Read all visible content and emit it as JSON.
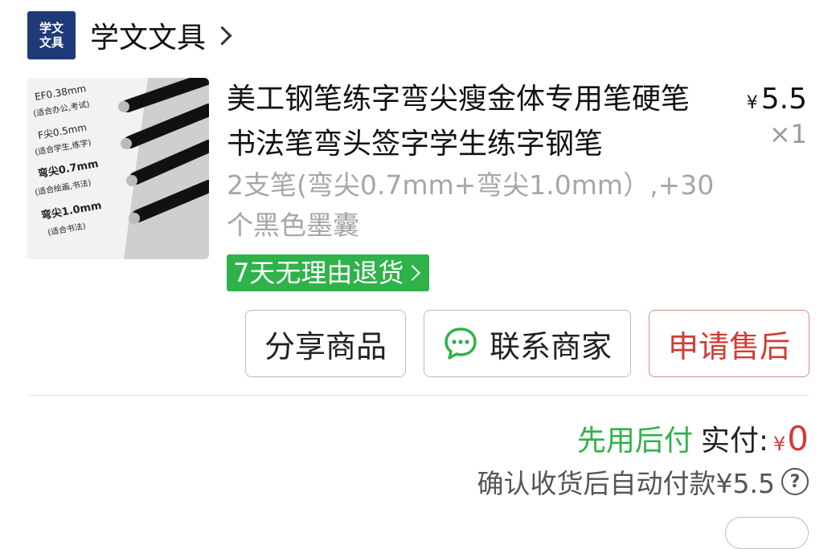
{
  "store": {
    "logo_line1": "学文",
    "logo_line2": "文具",
    "name": "学文文具",
    "chevron_icon": "chevron-right-icon"
  },
  "product": {
    "title": "美工钢笔练字弯尖瘦金体专用笔硬笔书法笔弯头签字学生练字钢笔",
    "price_symbol": "¥",
    "price": "5.5",
    "quantity": "×1",
    "variant": "2支笔(弯尖0.7mm+弯尖1.0mm）,+30个黑色墨囊",
    "return_badge": "7天无理由退货",
    "thumbnail": {
      "labels": [
        "EF0.38mm",
        "(适合办公,考试)",
        "F尖0.5mm",
        "(适合学生,练字)",
        "弯尖0.7mm",
        "(适合绘画,书法)",
        "弯尖1.0mm",
        "(适合书法)"
      ]
    }
  },
  "actions": {
    "share": "分享商品",
    "contact": "联系商家",
    "after_sale": "申请售后"
  },
  "payment": {
    "pay_later": "先用后付",
    "paid_label": "实付:",
    "paid_symbol": "¥",
    "paid_value": "0",
    "auto_pay_note": "确认收货后自动付款¥5.5",
    "help_icon": "question-circle-icon"
  },
  "colors": {
    "green": "#2fb24a",
    "red": "#d33b34",
    "logo_bg": "#1e3a78"
  }
}
